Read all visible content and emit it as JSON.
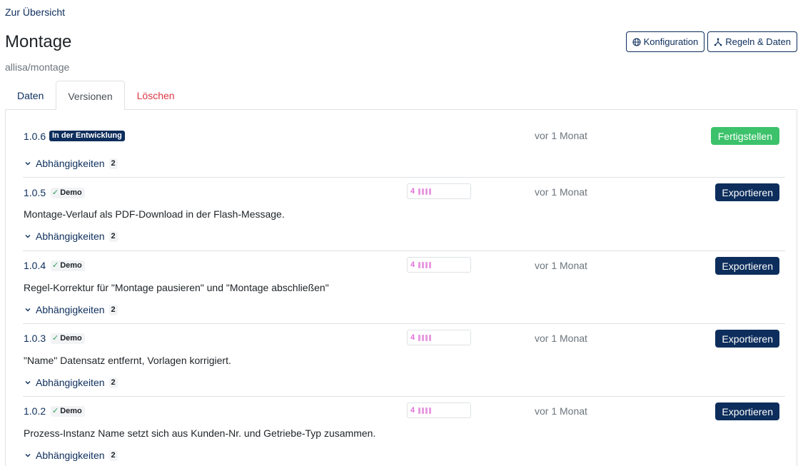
{
  "nav": {
    "back_label": "Zur Übersicht"
  },
  "page": {
    "title": "Montage",
    "subtitle": "allisa/montage"
  },
  "actions": {
    "config_label": "Konfiguration",
    "rules_label": "Regeln & Daten"
  },
  "tabs": [
    {
      "label": "Daten"
    },
    {
      "label": "Versionen"
    },
    {
      "label": "Löschen"
    }
  ],
  "versions": [
    {
      "number": "1.0.6",
      "badge": "In der Entwicklung",
      "time": "vor 1 Monat",
      "action": "Fertigstellen",
      "deps_label": "Abhängigkeiten",
      "deps_count": "2"
    },
    {
      "number": "1.0.5",
      "tag": "Demo",
      "meter": "4",
      "time": "vor 1 Monat",
      "action": "Exportieren",
      "description": "Montage-Verlauf als PDF-Download in der Flash-Message.",
      "deps_label": "Abhängigkeiten",
      "deps_count": "2"
    },
    {
      "number": "1.0.4",
      "tag": "Demo",
      "meter": "4",
      "time": "vor 1 Monat",
      "action": "Exportieren",
      "description": "Regel-Korrektur für \"Montage pausieren\" und \"Montage abschließen\"",
      "deps_label": "Abhängigkeiten",
      "deps_count": "2"
    },
    {
      "number": "1.0.3",
      "tag": "Demo",
      "meter": "4",
      "time": "vor 1 Monat",
      "action": "Exportieren",
      "description": "\"Name\" Datensatz entfernt, Vorlagen korrigiert.",
      "deps_label": "Abhängigkeiten",
      "deps_count": "2"
    },
    {
      "number": "1.0.2",
      "tag": "Demo",
      "meter": "4",
      "time": "vor 1 Monat",
      "action": "Exportieren",
      "description": "Prozess-Instanz Name setzt sich aus Kunden-Nr. und Getriebe-Typ zusammen.",
      "deps_label": "Abhängigkeiten",
      "deps_count": "2"
    }
  ],
  "colors": {
    "primary": "#0d2e5c",
    "success": "#3cc26b",
    "danger": "#dc3545",
    "meter": "#e36fd8"
  }
}
